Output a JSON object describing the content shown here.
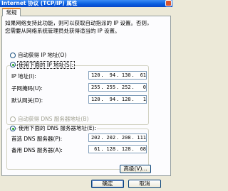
{
  "window": {
    "title": "Internet 协议 (TCP/IP) 属性"
  },
  "tabs": [
    {
      "label": "常规"
    }
  ],
  "description": {
    "line1": "如果网络支持此功能，则可以获取自动指派的 IP 设置。否则，",
    "line2": "您需要从网络系统管理员处获得适当的 IP 设置。"
  },
  "ip_mode": {
    "auto_label": "自动获得 IP 地址(O)",
    "manual_label": "使用下面的 IP 地址(S):",
    "selected": "manual"
  },
  "ip_fields": [
    {
      "label": "IP 地址(I):",
      "octets": [
        "120",
        "94",
        "130",
        "61"
      ]
    },
    {
      "label": "子网掩码(U):",
      "octets": [
        "255",
        "255",
        "252",
        "0"
      ]
    },
    {
      "label": "默认网关(D):",
      "octets": [
        "120",
        "94",
        "128",
        "1"
      ]
    }
  ],
  "dns_mode": {
    "auto_label": "自动获得 DNS 服务器地址(B)",
    "manual_label": "使用下面的 DNS 服务器地址(E):",
    "selected": "manual"
  },
  "dns_fields": [
    {
      "label": "首选 DNS 服务器(P):",
      "octets": [
        "202",
        "202",
        "208",
        "111"
      ]
    },
    {
      "label": "备用 DNS 服务器(A):",
      "octets": [
        "61",
        "128",
        "128",
        "68"
      ]
    }
  ],
  "buttons": {
    "advanced": "高级(V)...",
    "ok": "确定",
    "cancel": "取消"
  }
}
